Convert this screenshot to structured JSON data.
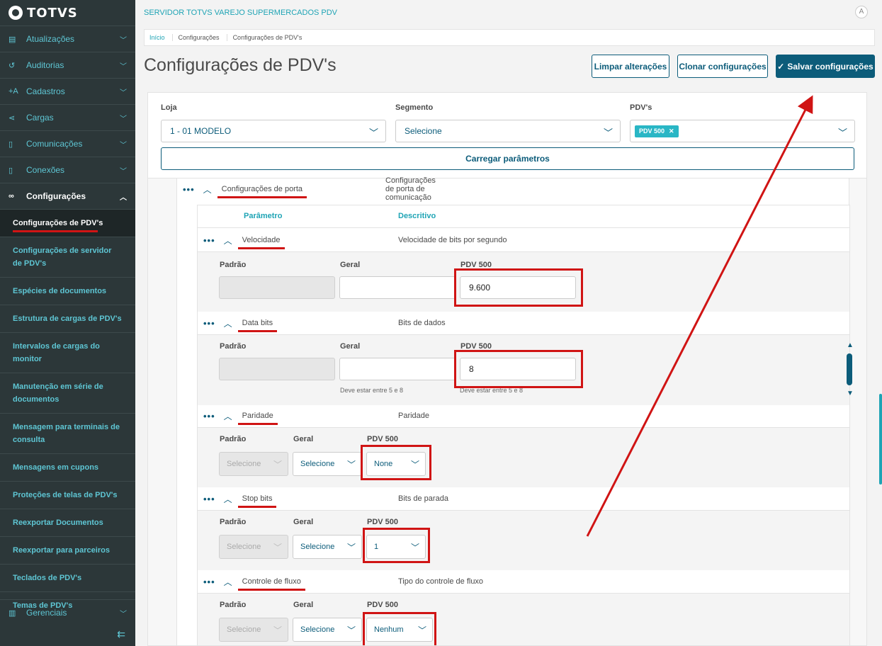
{
  "sidebar": {
    "logo_text": "TOTVS",
    "menu": [
      {
        "label": "Atualizações",
        "icon": "server-icon"
      },
      {
        "label": "Auditorias",
        "icon": "history-icon"
      },
      {
        "label": "Cadastros",
        "icon": "add-text-icon"
      },
      {
        "label": "Cargas",
        "icon": "share-icon"
      },
      {
        "label": "Comunicações",
        "icon": "document-icon"
      },
      {
        "label": "Conexões",
        "icon": "document-icon"
      },
      {
        "label": "Configurações",
        "icon": "link-icon"
      }
    ],
    "submenu": [
      "Configurações de PDV's",
      "Configurações de servidor de PDV's",
      "Espécies de documentos",
      "Estrutura de cargas de PDV's",
      "Intervalos de cargas do monitor",
      "Manutenção em série de documentos",
      "Mensagem para terminais de consulta",
      "Mensagens em cupons",
      "Proteções de telas de PDV's",
      "Reexportar Documentos",
      "Reexportar para parceiros",
      "Teclados de PDV's",
      "Temas de PDV's"
    ],
    "last_menu": "Gerenciais"
  },
  "header": {
    "server_title": "SERVIDOR TOTVS VAREJO SUPERMERCADOS PDV",
    "user_icon": "A"
  },
  "breadcrumb": [
    "Início",
    "Configurações",
    "Configurações de PDV's"
  ],
  "page_title": "Configurações de PDV's",
  "actions": {
    "clear": "Limpar alterações",
    "clone": "Clonar configurações",
    "save": "Salvar configurações"
  },
  "filters": {
    "loja_label": "Loja",
    "loja_value": "1 - 01 MODELO",
    "segmento_label": "Segmento",
    "segmento_value": "Selecione",
    "pdvs_label": "PDV's",
    "pdv_tag": "PDV 500",
    "load_button": "Carregar parâmetros"
  },
  "group": {
    "name": "Configurações de porta",
    "description": "Configurações de porta de comunicação"
  },
  "table_headers": {
    "param": "Parâmetro",
    "desc": "Descritivo"
  },
  "params": {
    "velocidade": {
      "name": "Velocidade",
      "desc": "Velocidade de bits por segundo",
      "pdv_value": "9.600"
    },
    "databits": {
      "name": "Data bits",
      "desc": "Bits de dados",
      "pdv_value": "8",
      "hint": "Deve estar entre 5 e 8"
    },
    "paridade": {
      "name": "Paridade",
      "desc": "Paridade",
      "pdv_value": "None"
    },
    "stopbits": {
      "name": "Stop bits",
      "desc": "Bits de parada",
      "pdv_value": "1"
    },
    "fluxo": {
      "name": "Controle de fluxo",
      "desc": "Tipo do controle de fluxo",
      "pdv_value": "Nenhum"
    }
  },
  "field_labels": {
    "padrao": "Padrão",
    "geral": "Geral",
    "pdv": "PDV 500"
  },
  "select_placeholder": "Selecione",
  "colors": {
    "sidebar": "#2c3739",
    "accent": "#1fa4b5",
    "primary": "#0c5c7a",
    "annotation": "#d01414"
  }
}
